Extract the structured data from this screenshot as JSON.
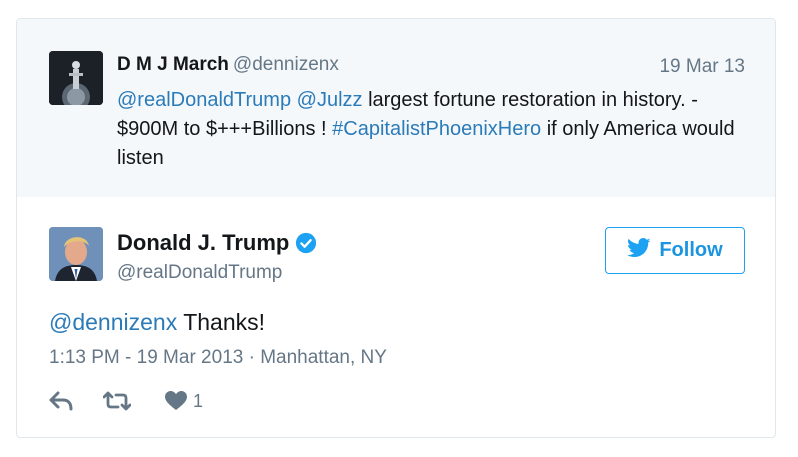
{
  "quoted": {
    "display_name": "D M J March",
    "handle": "@dennizenx",
    "date": "19 Mar 13",
    "text": {
      "mention1": "@realDonaldTrump",
      "mention2": "@Julzz",
      "part1": " largest fortune restoration in history. - $900M to $+++Billions ! ",
      "hashtag": "#CapitalistPhoenixHero",
      "part2": " if only America would listen"
    }
  },
  "tweet": {
    "display_name": "Donald J. Trump",
    "handle": "@realDonaldTrump",
    "verified": true,
    "follow_label": "Follow",
    "text": {
      "mention": "@dennizenx",
      "body": " Thanks!"
    },
    "meta": "1:13 PM - 19 Mar 2013 · Manhattan, NY",
    "actions": {
      "reply_icon": "reply-icon",
      "retweet_icon": "retweet-icon",
      "like_icon": "heart-icon",
      "like_count": "1"
    }
  },
  "colors": {
    "link": "#2b7bb9",
    "twitter_blue": "#1da1f2",
    "muted": "#657786",
    "quoted_bg": "#f5f8fa"
  }
}
